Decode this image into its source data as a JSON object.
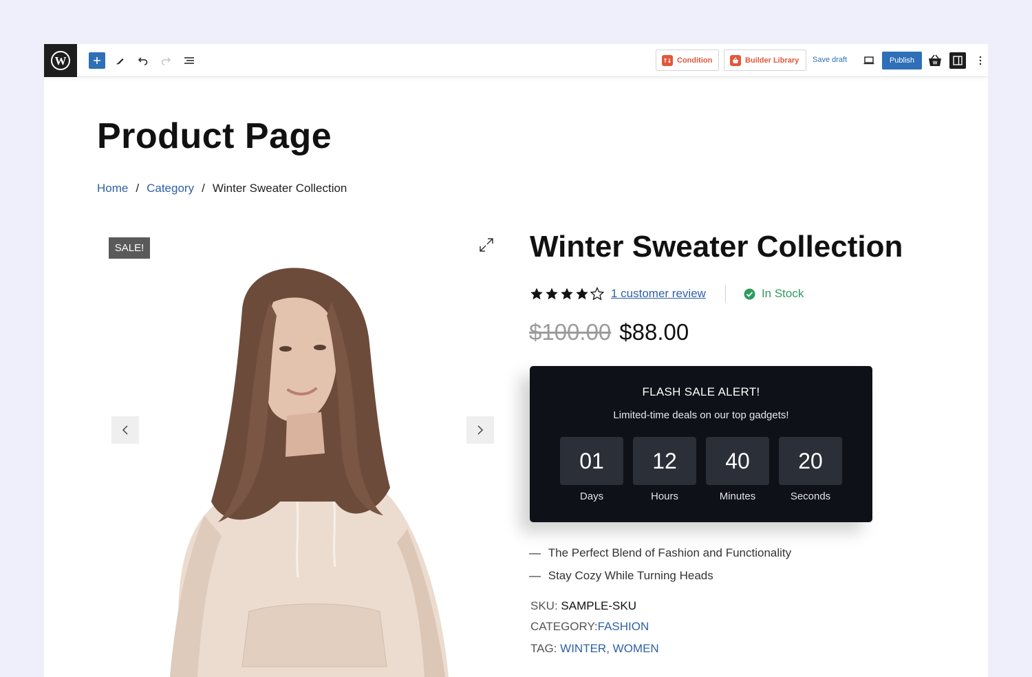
{
  "toolbar": {
    "condition_label": "Condition",
    "builder_library_label": "Builder Library",
    "save_draft_label": "Save draft",
    "publish_label": "Publish",
    "colors": {
      "accent": "#2f6fb8",
      "plugin": "#e2573b"
    }
  },
  "page": {
    "title": "Product Page",
    "breadcrumb": [
      "Home",
      "Category",
      "Winter Sweater Collection"
    ],
    "breadcrumb_separator": "/"
  },
  "gallery": {
    "badge": "SALE!"
  },
  "product": {
    "title": "Winter Sweater Collection",
    "rating": 4,
    "rating_max": 5,
    "review_link": "1 customer review",
    "stock_status": "In Stock",
    "old_price": "$100.00",
    "price": "$88.00",
    "features": [
      "The Perfect Blend of Fashion and Functionality",
      "Stay Cozy While Turning Heads"
    ],
    "feature_dash": "—",
    "sku_label": "SKU:",
    "sku_value": "SAMPLE-SKU",
    "category_label": "CATEGORY:",
    "category_value": "FASHION",
    "tag_label": "TAG:",
    "tag_value": "WINTER, WOMEN"
  },
  "flash_sale": {
    "title": "FLASH SALE ALERT!",
    "subtitle": "Limited-time deals on our top gadgets!",
    "countdown": [
      {
        "value": "01",
        "label": "Days"
      },
      {
        "value": "12",
        "label": "Hours"
      },
      {
        "value": "40",
        "label": "Minutes"
      },
      {
        "value": "20",
        "label": "Seconds"
      }
    ]
  }
}
